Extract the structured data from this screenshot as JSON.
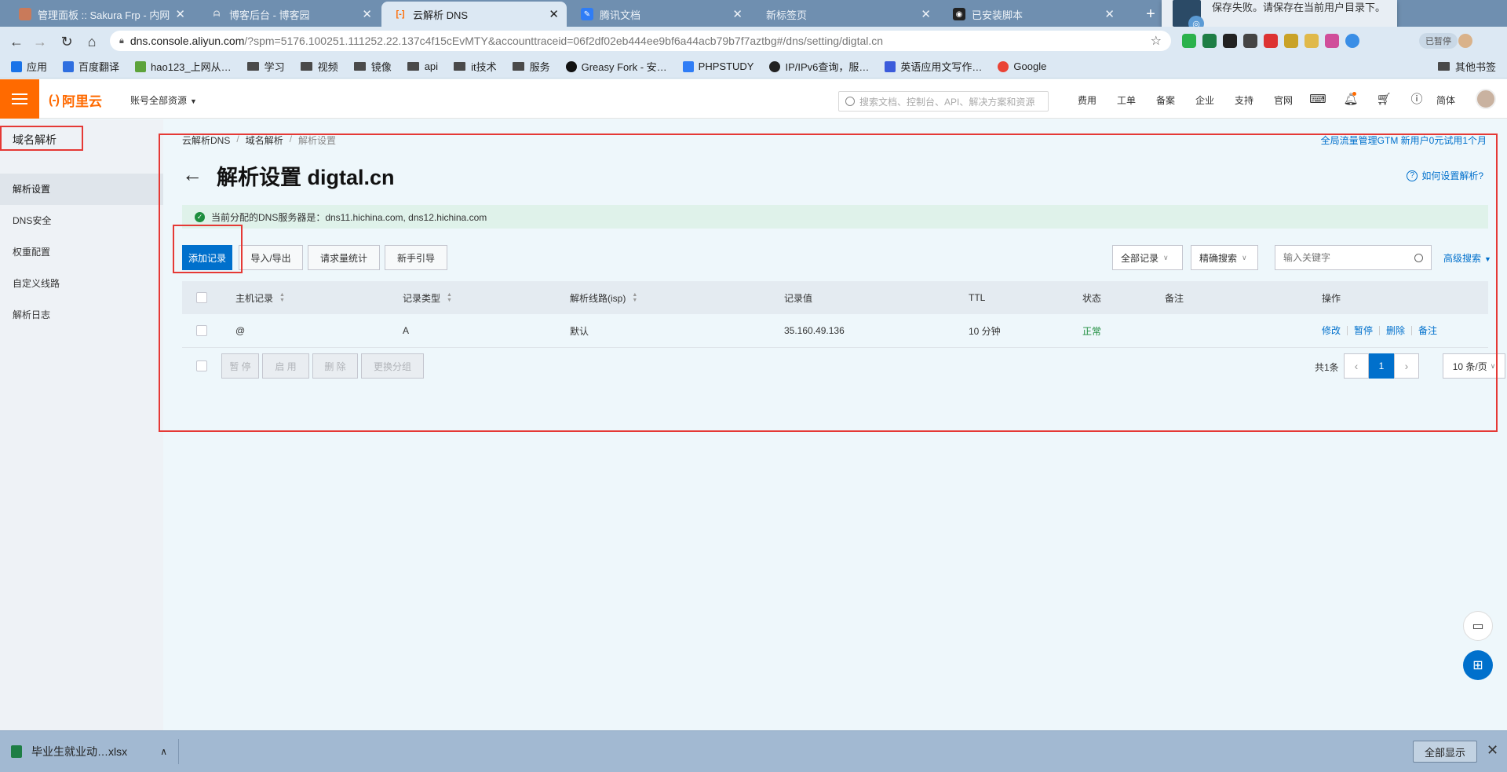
{
  "browser": {
    "tabs": [
      {
        "title": "管理面板 :: Sakura Frp - 内网穿",
        "active": false,
        "favicon_color": "#c97a5a"
      },
      {
        "title": "博客后台 - 博客园",
        "active": false,
        "favicon_color": "#6f8fb0"
      },
      {
        "title": "云解析 DNS",
        "active": true,
        "favicon_color": "#ff6a00"
      },
      {
        "title": "腾讯文档",
        "active": false,
        "favicon_color": "#2f7df6"
      },
      {
        "title": "新标签页",
        "active": false,
        "favicon_color": ""
      },
      {
        "title": "已安装脚本",
        "active": false,
        "favicon_color": "#222222"
      }
    ],
    "new_tab_label": "+",
    "notification": {
      "message": "保存失败。请保存在当前用户目录下。"
    },
    "address": {
      "host": "dns.console.aliyun.com",
      "path": "/?spm=5176.100251.111252.22.137c4f15cEvMTY&accounttraceid=06f2df02eb444ee9bf6a44acb79b7f7aztbg#/dns/setting/digtal.cn"
    },
    "profile_label": "已暂停",
    "bookmarks": [
      {
        "label": "应用",
        "kind": "apps"
      },
      {
        "label": "百度翻译",
        "kind": "site",
        "color": "#2f6fe0"
      },
      {
        "label": "hao123_上网从…",
        "kind": "site",
        "color": "#5da33b"
      },
      {
        "label": "学习",
        "kind": "folder"
      },
      {
        "label": "视频",
        "kind": "folder"
      },
      {
        "label": "镜像",
        "kind": "folder"
      },
      {
        "label": "api",
        "kind": "folder"
      },
      {
        "label": "it技术",
        "kind": "folder"
      },
      {
        "label": "服务",
        "kind": "folder"
      },
      {
        "label": "Greasy Fork - 安…",
        "kind": "site",
        "color": "#111111"
      },
      {
        "label": "PHPSTUDY",
        "kind": "site",
        "color": "#2f7df6"
      },
      {
        "label": "IP/IPv6查询，服…",
        "kind": "site",
        "color": "#222222"
      },
      {
        "label": "英语应用文写作…",
        "kind": "site",
        "color": "#3b5bdb"
      },
      {
        "label": "Google",
        "kind": "site",
        "color": "#ea4335"
      }
    ],
    "other_bookmarks": "其他书签"
  },
  "console": {
    "logo_text": "阿里云",
    "account_menu": "账号全部资源",
    "search_placeholder": "搜索文档、控制台、API、解决方案和资源",
    "nav": [
      "费用",
      "工单",
      "备案",
      "企业",
      "支持",
      "官网"
    ],
    "lang": "简体"
  },
  "sidebar": {
    "title": "域名解析",
    "items": [
      {
        "label": "解析设置",
        "active": true
      },
      {
        "label": "DNS安全",
        "active": false
      },
      {
        "label": "权重配置",
        "active": false
      },
      {
        "label": "自定义线路",
        "active": false
      },
      {
        "label": "解析日志",
        "active": false
      }
    ]
  },
  "main": {
    "breadcrumb": [
      "云解析DNS",
      "域名解析",
      "解析设置"
    ],
    "promo": "全局流量管理GTM 新用户0元试用1个月",
    "title": "解析设置 digtal.cn",
    "help": "如何设置解析?",
    "dns_banner": "当前分配的DNS服务器是：dns11.hichina.com, dns12.hichina.com",
    "buttons": {
      "add": "添加记录",
      "import": "导入/导出",
      "stats": "请求量统计",
      "guide": "新手引导"
    },
    "filters": {
      "all_records": "全部记录",
      "exact": "精确搜索",
      "keyword_placeholder": "输入关键字",
      "advanced": "高级搜索"
    },
    "table": {
      "headers": [
        "主机记录",
        "记录类型",
        "解析线路(isp)",
        "记录值",
        "TTL",
        "状态",
        "备注",
        "操作"
      ],
      "rows": [
        {
          "host": "@",
          "type": "A",
          "line": "默认",
          "value": "35.160.49.136",
          "ttl": "10 分钟",
          "status": "正常",
          "remark": "",
          "ops": [
            "修改",
            "暂停",
            "删除",
            "备注"
          ]
        }
      ]
    },
    "bulk": [
      "暂 停",
      "启 用",
      "删 除",
      "更换分组"
    ],
    "pagination": {
      "total": "共1条",
      "current": "1",
      "page_size": "10 条/页"
    }
  },
  "download": {
    "file": "毕业生就业动…xlsx",
    "show_all": "全部显示"
  },
  "colors": {
    "brand": "#ff6a00",
    "primary": "#0070cc",
    "success": "#1e8e3e",
    "annotation": "#e53935"
  }
}
